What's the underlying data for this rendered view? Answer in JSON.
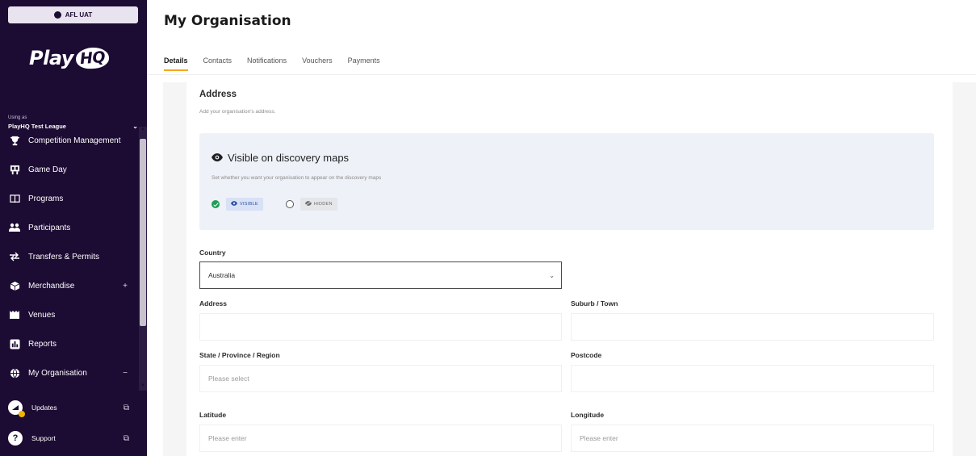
{
  "sidebar": {
    "env_badge": "AFL UAT",
    "logo_play": "Play",
    "logo_hq": "HQ",
    "using_as_label": "Using as",
    "league_name": "PlayHQ Test League",
    "items": [
      {
        "label": "Competition Management",
        "icon": "trophy-icon",
        "glyph": "🏆"
      },
      {
        "label": "Game Day",
        "icon": "scoreboard-icon",
        "glyph": "▦"
      },
      {
        "label": "Programs",
        "icon": "book-icon",
        "glyph": "📖"
      },
      {
        "label": "Participants",
        "icon": "people-icon",
        "glyph": "👥"
      },
      {
        "label": "Transfers & Permits",
        "icon": "transfer-icon",
        "glyph": "⇄"
      },
      {
        "label": "Merchandise",
        "icon": "box-icon",
        "glyph": "▣",
        "trail": "+"
      },
      {
        "label": "Venues",
        "icon": "venue-icon",
        "glyph": "♜"
      },
      {
        "label": "Reports",
        "icon": "chart-icon",
        "glyph": "▥"
      },
      {
        "label": "My Organisation",
        "icon": "globe-icon",
        "glyph": "⊕",
        "trail": "−"
      }
    ],
    "updates_label": "Updates",
    "support_label": "Support"
  },
  "main": {
    "title": "My Organisation",
    "tabs": [
      {
        "label": "Details"
      },
      {
        "label": "Contacts"
      },
      {
        "label": "Notifications"
      },
      {
        "label": "Vouchers"
      },
      {
        "label": "Payments"
      }
    ],
    "address_title": "Address",
    "address_sub": "Add your organisation's address.",
    "discovery": {
      "title": "Visible on discovery maps",
      "subtitle": "Set whether you want your organisation to appear on the discovery maps",
      "visible_label": "VISIBLE",
      "hidden_label": "HIDDEN"
    },
    "form": {
      "country_label": "Country",
      "country_value": "Australia",
      "address_label": "Address",
      "suburb_label": "Suburb / Town",
      "state_label": "State / Province / Region",
      "state_placeholder": "Please select",
      "postcode_label": "Postcode",
      "latitude_label": "Latitude",
      "latitude_placeholder": "Please enter",
      "longitude_label": "Longitude",
      "longitude_placeholder": "Please enter"
    }
  }
}
